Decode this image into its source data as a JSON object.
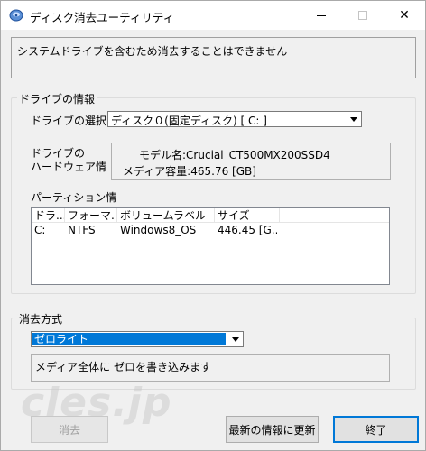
{
  "window": {
    "title": "ディスク消去ユーティリティ",
    "controls": {
      "minimize": "minimize",
      "maximize": "maximize",
      "close": "✕"
    }
  },
  "message": "システムドライブを含むため消去することはできません",
  "drive_info": {
    "legend": "ドライブの情報",
    "select_label": "ドライブの選択",
    "selected_drive": "ディスク０(固定ディスク) [ C:    ]",
    "hw_label_line1": "ドライブの",
    "hw_label_line2": "ハードウェア情",
    "model_label": "モデル名:",
    "model_value": "Crucial_CT500MX200SSD4",
    "capacity_label": "メディア容量:",
    "capacity_value": "465.76 [GB]",
    "partition_label": "パーティション情",
    "partition_columns": [
      "ドラ...",
      "フォーマ...",
      "ボリュームラベル",
      "サイズ"
    ],
    "partitions": [
      {
        "drive": "C:",
        "format": "NTFS",
        "label": "Windows8_OS",
        "size": "446.45 [G..."
      }
    ]
  },
  "erase": {
    "legend": "消去方式",
    "method": "ゼロライト",
    "description": "メディア全体に ゼロを書き込みます"
  },
  "buttons": {
    "erase": "消去",
    "refresh": "最新の情報に更新",
    "exit": "終了"
  },
  "watermark": "cles.jp",
  "colors": {
    "accent": "#0078d7",
    "window_bg": "#f0f0f0"
  }
}
